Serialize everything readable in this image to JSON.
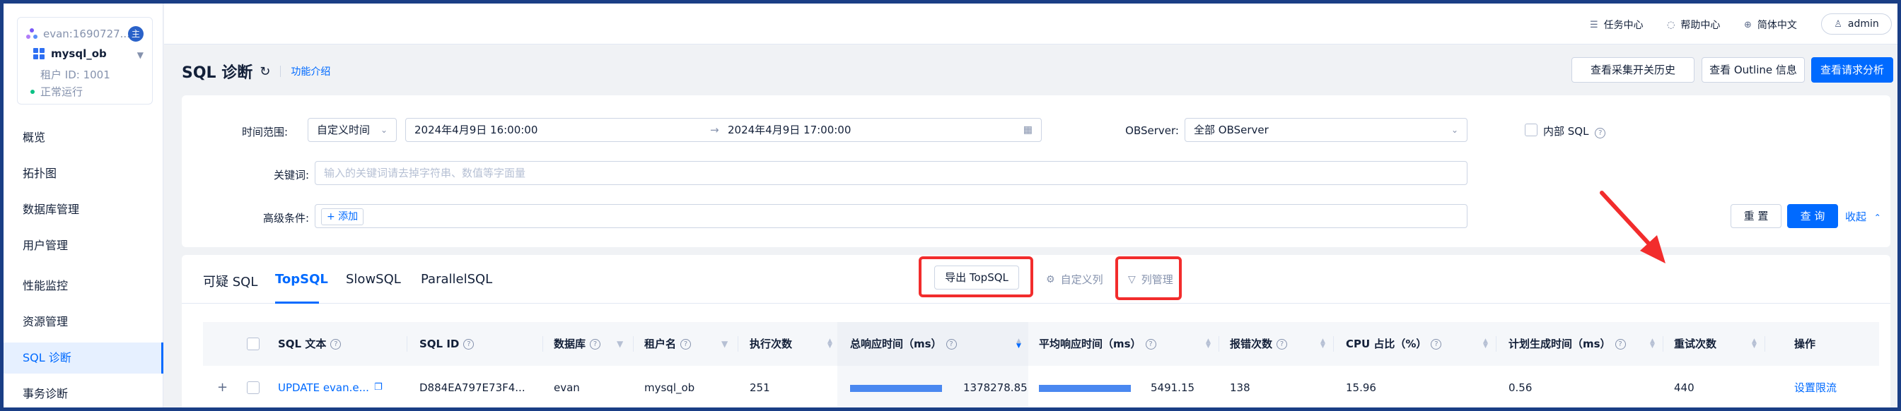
{
  "sidebar": {
    "tenant": {
      "user": "evan:1690727...",
      "badge": "主",
      "name": "mysql_ob",
      "tenant_id": "租户 ID: 1001",
      "status": "正常运行"
    },
    "items": [
      {
        "label": "概览"
      },
      {
        "label": "拓扑图"
      },
      {
        "label": "数据库管理"
      },
      {
        "label": "用户管理"
      },
      {
        "label": "性能监控"
      },
      {
        "label": "资源管理"
      },
      {
        "label": "SQL 诊断"
      },
      {
        "label": "事务诊断"
      }
    ]
  },
  "topbar": {
    "task_center": "任务中心",
    "help_center": "帮助中心",
    "language": "简体中文",
    "user": "admin"
  },
  "header": {
    "title": "SQL 诊断",
    "intro_link": "功能介绍",
    "btn_history": "查看采集开关历史",
    "btn_outline": "查看 Outline 信息",
    "btn_analysis": "查看请求分析"
  },
  "filters": {
    "time_label": "时间范围:",
    "time_mode": "自定义时间",
    "time_start": "2024年4月9日 16:00:00",
    "time_arrow": "→",
    "time_end": "2024年4月9日 17:00:00",
    "observer_label": "OBServer:",
    "observer_value": "全部 OBServer",
    "internal_sql": "内部 SQL",
    "keyword_label": "关键词:",
    "keyword_placeholder": "输入的关键词请去掉字符串、数值等字面量",
    "advanced_label": "高级条件:",
    "add_label": "+ 添加",
    "reset": "重 置",
    "query": "查 询",
    "collapse": "收起"
  },
  "results": {
    "tabs": [
      "可疑 SQL",
      "TopSQL",
      "SlowSQL",
      "ParallelSQL"
    ],
    "active_tab": "TopSQL",
    "export_btn": "导出 TopSQL",
    "custom_columns": "自定义列",
    "column_manage": "列管理",
    "columns": [
      "SQL 文本",
      "SQL ID",
      "数据库",
      "租户名",
      "执行次数",
      "总响应时间（ms）",
      "平均响应时间（ms）",
      "报错次数",
      "CPU 占比（%）",
      "计划生成时间（ms）",
      "重试次数",
      "操作"
    ],
    "rows": [
      {
        "sql_text": "UPDATE evan.e...",
        "sql_id": "D884EA797E73F4...",
        "database": "evan",
        "tenant": "mysql_ob",
        "exec_count": "251",
        "total_resp": "1378278.85",
        "total_resp_pct": 0.9,
        "avg_resp": "5491.15",
        "avg_resp_pct": 0.9,
        "errors": "138",
        "cpu_pct": "15.96",
        "plan_time": "0.56",
        "retries": "440",
        "action": "设置限流"
      }
    ]
  },
  "colors": {
    "primary": "#006aff",
    "annotation_red": "#f22c2c",
    "bar_blue": "#4a88f0"
  }
}
